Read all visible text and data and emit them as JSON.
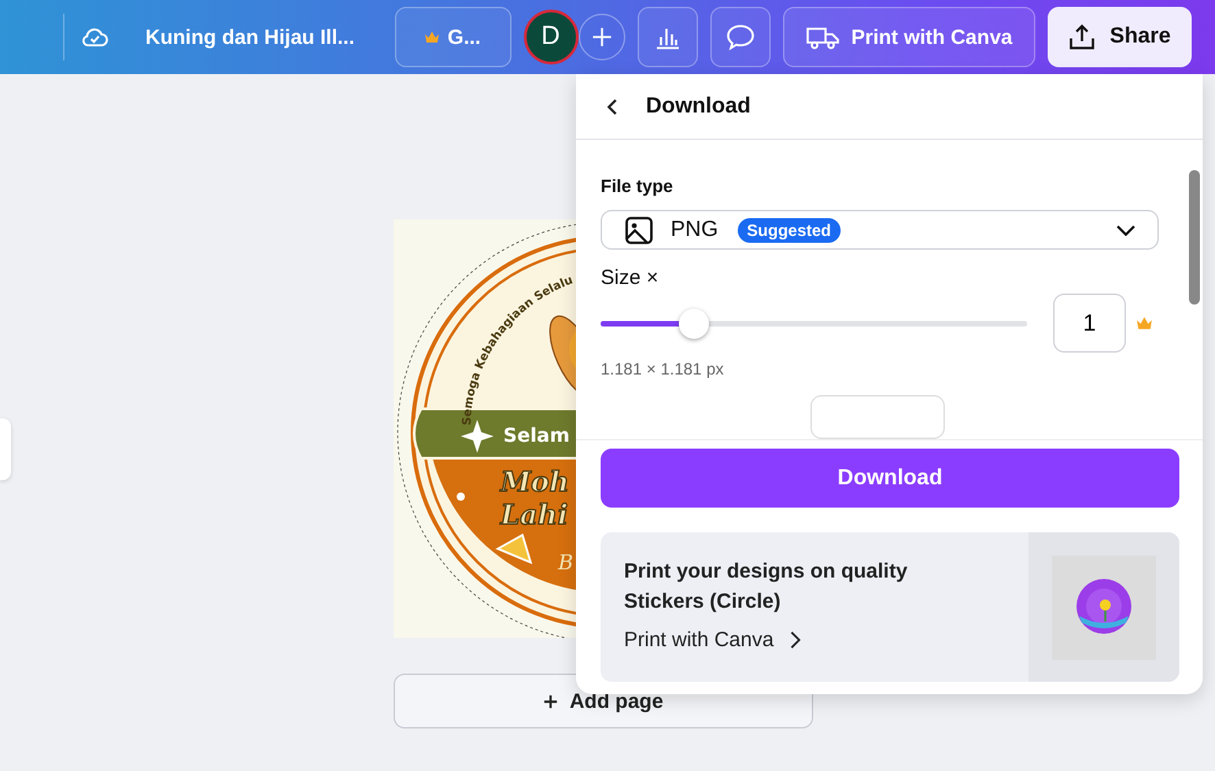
{
  "topbar": {
    "document_title": "Kuning dan Hijau Ill...",
    "upgrade_label": "G...",
    "avatar_initial": "D",
    "print_button": "Print with Canva",
    "share_button": "Share"
  },
  "design": {
    "arc_text": "Semoga Kebahagiaan Selalu",
    "banner_text": "Selam",
    "title_lines": [
      "Moh",
      "Lahi"
    ],
    "subtitle": "B"
  },
  "add_page": "Add page",
  "download_panel": {
    "title": "Download",
    "file_type_label": "File type",
    "file_type": "PNG",
    "file_type_badge": "Suggested",
    "size": {
      "label": "Size ×",
      "level": 0.21,
      "value": "1",
      "dimensions": "1.181 × 1.181 px"
    },
    "download_button": "Download",
    "promo": {
      "title": "Print your designs on quality Stickers (Circle)",
      "link": "Print with Canva",
      "kind": "picture"
    }
  }
}
